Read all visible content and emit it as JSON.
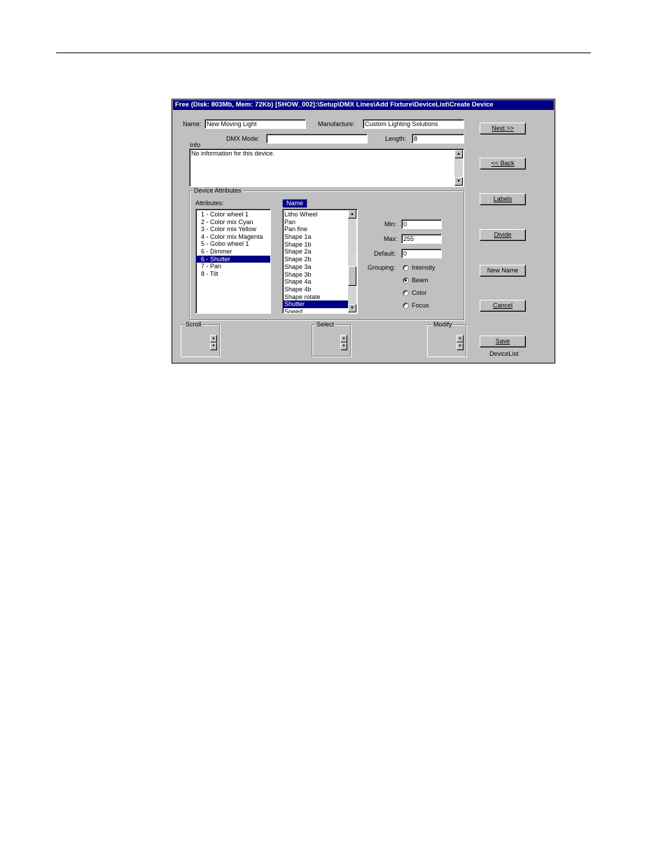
{
  "window": {
    "title": "Free (Disk: 803Mb, Mem: 72Kb)    [SHOW_002]:\\Setup\\DMX Lines\\Add Fixture\\DeviceList\\Create Device"
  },
  "form": {
    "name_label": "Name:",
    "name_value": "New Moving Light",
    "manufacturer_label": "Manufacture:",
    "manufacturer_value": "Custom Lighting Solutions",
    "dmx_mode_label": "DMX Mode:",
    "dmx_mode_value": "",
    "length_label": "Length:",
    "length_value": "8",
    "info_label": "Info",
    "info_value": "No information for this device."
  },
  "device_attributes": {
    "group_label": "Device Attributes",
    "attributes_label": "Attributes:",
    "attributes": [
      {
        "label": "1 - Color wheel 1",
        "selected": false
      },
      {
        "label": "2 - Color mix Cyan",
        "selected": false
      },
      {
        "label": "3 - Color mix Yellow",
        "selected": false
      },
      {
        "label": "4 - Color mix Magenta",
        "selected": false
      },
      {
        "label": "5 - Gobo wheel 1",
        "selected": false
      },
      {
        "label": "6 - Dimmer",
        "selected": false
      },
      {
        "label": "6 - Shutter",
        "selected": true
      },
      {
        "label": "7 - Pan",
        "selected": false
      },
      {
        "label": "8 - Tilt",
        "selected": false
      }
    ],
    "names_header": "Name",
    "names": [
      {
        "label": "Litho Wheel",
        "selected": false
      },
      {
        "label": "Pan",
        "selected": false
      },
      {
        "label": "Pan fine",
        "selected": false
      },
      {
        "label": "Shape 1a",
        "selected": false
      },
      {
        "label": "Shape 1b",
        "selected": false
      },
      {
        "label": "Shape 2a",
        "selected": false
      },
      {
        "label": "Shape 2b",
        "selected": false
      },
      {
        "label": "Shape 3a",
        "selected": false
      },
      {
        "label": "Shape 3b",
        "selected": false
      },
      {
        "label": "Shape 4a",
        "selected": false
      },
      {
        "label": "Shape 4b",
        "selected": false
      },
      {
        "label": "Shape rotate",
        "selected": false
      },
      {
        "label": "Shutter",
        "selected": true
      },
      {
        "label": "Speed",
        "selected": false
      }
    ],
    "min_label": "Min:",
    "min_value": "0",
    "max_label": "Max:",
    "max_value": "255",
    "default_label": "Default:",
    "default_value": "0",
    "grouping_label": "Grouping:",
    "grouping_options": [
      {
        "label": "Intensity",
        "checked": false
      },
      {
        "label": "Beam",
        "checked": true
      },
      {
        "label": "Color",
        "checked": false
      },
      {
        "label": "Focus",
        "checked": false
      }
    ]
  },
  "bottom_groups": {
    "scroll": "Scroll",
    "select": "Select",
    "modify": "Modify"
  },
  "buttons": {
    "next": "Next >>",
    "back": "<< Back",
    "labels": "Labels",
    "divide": "Divide",
    "new_name": "New Name",
    "cancel": "Cancel",
    "save": "Save",
    "save_caption": "DeviceList"
  },
  "colors": {
    "titlebar": "#000080",
    "face": "#c0c0c0",
    "selection": "#000080"
  }
}
